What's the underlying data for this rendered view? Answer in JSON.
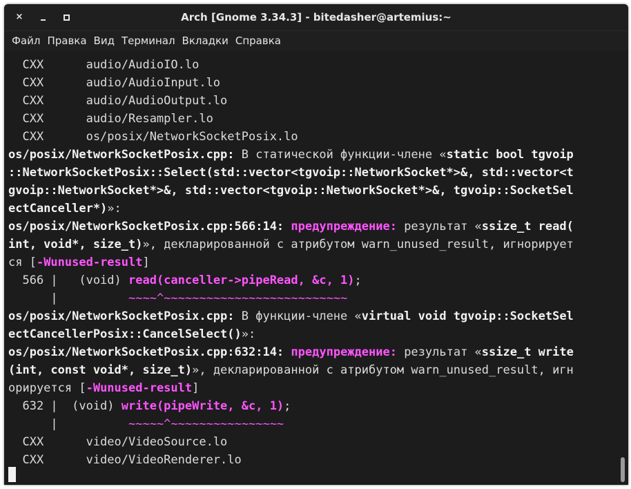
{
  "window": {
    "title": "Arch [Gnome 3.34.3] - bitedasher@artemius:~",
    "buttons": {
      "close": "×"
    }
  },
  "menu": [
    "Файл",
    "Правка",
    "Вид",
    "Терминал",
    "Вкладки",
    "Справка"
  ],
  "terminal": {
    "l1": "  CXX      audio/AudioIO.lo",
    "l2": "  CXX      audio/AudioInput.lo",
    "l3": "  CXX      audio/AudioOutput.lo",
    "l4": "  CXX      audio/Resampler.lo",
    "l5": "  CXX      os/posix/NetworkSocketPosix.lo",
    "l6a": "os/posix/NetworkSocketPosix.cpp:",
    "l6b": " В статической функции-члене «",
    "l6c": "static bool tgvoip",
    "l7": "::NetworkSocketPosix::Select(std::vector<tgvoip::NetworkSocket*>&, std::vector<t",
    "l8": "gvoip::NetworkSocket*>&, std::vector<tgvoip::NetworkSocket*>&, tgvoip::SocketSel",
    "l9a": "ectCanceller*)",
    "l9b": "»:",
    "l10a": "os/posix/NetworkSocketPosix.cpp:566:14:",
    "l10b": " ",
    "l10c": "предупреждение:",
    "l10d": " результат «",
    "l10e": "ssize_t read(",
    "l11a": "int, void*, size_t)",
    "l11b": "», декларированной с атрибутом warn_unused_result, игнорирует",
    "l12a": "ся [",
    "l12b": "-Wunused-result",
    "l12c": "]",
    "l13a": "  566 |   (void) ",
    "l13b": "read(canceller->pipeRead, &c, 1)",
    "l13c": ";",
    "l14a": "      |          ",
    "l14b": "~~~~^~~~~~~~~~~~~~~~~~~~~~~~~~~",
    "l15a": "os/posix/NetworkSocketPosix.cpp:",
    "l15b": " В функции-члене «",
    "l15c": "virtual void tgvoip::SocketSel",
    "l16a": "ectCancellerPosix::CancelSelect()",
    "l16b": "»:",
    "l17a": "os/posix/NetworkSocketPosix.cpp:632:14:",
    "l17b": " ",
    "l17c": "предупреждение:",
    "l17d": " результат «",
    "l17e": "ssize_t write",
    "l18a": "(int, const void*, size_t)",
    "l18b": "», декларированной с атрибутом warn_unused_result, игн",
    "l19a": "орируется [",
    "l19b": "-Wunused-result",
    "l19c": "]",
    "l20a": "  632 |  (void) ",
    "l20b": "write(pipeWrite, &c, 1)",
    "l20c": ";",
    "l21a": "      |          ",
    "l21b": "~~~~~^~~~~~~~~~~~~~~~~",
    "l22": "  CXX      video/VideoSource.lo",
    "l23": "  CXX      video/VideoRenderer.lo"
  },
  "colors": {
    "background": "#1c1c1c",
    "text": "#dcdcdc",
    "warning": "#ff55ff"
  }
}
